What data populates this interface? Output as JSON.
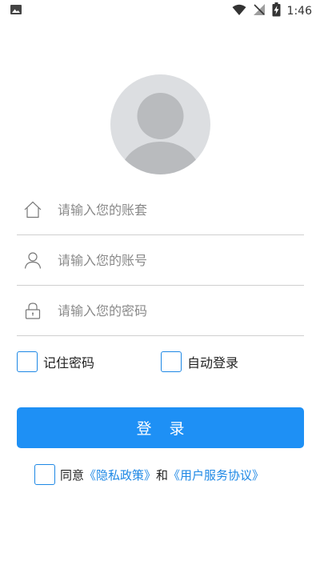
{
  "status_bar": {
    "time": "1:46",
    "icons": [
      "image-icon",
      "wifi-icon",
      "signal-off-icon",
      "battery-charging-icon"
    ]
  },
  "avatar": {
    "icon": "avatar-placeholder-icon"
  },
  "form": {
    "org": {
      "placeholder": "请输入您的账套",
      "value": "",
      "icon": "home-icon"
    },
    "account": {
      "placeholder": "请输入您的账号",
      "value": "",
      "icon": "user-icon"
    },
    "password": {
      "placeholder": "请输入您的密码",
      "value": "",
      "icon": "lock-icon"
    }
  },
  "options": {
    "remember_password": {
      "label": "记住密码",
      "checked": false
    },
    "auto_login": {
      "label": "自动登录",
      "checked": false
    }
  },
  "login_button": {
    "label": "登 录"
  },
  "agreement": {
    "prefix": "同意",
    "privacy_link": "《隐私政策》",
    "and": "和",
    "service_link": "《用户服务协议》",
    "checked": false
  },
  "colors": {
    "accent": "#1e90f5",
    "link": "#1e88e5",
    "avatar_bg": "#dcdee1"
  }
}
